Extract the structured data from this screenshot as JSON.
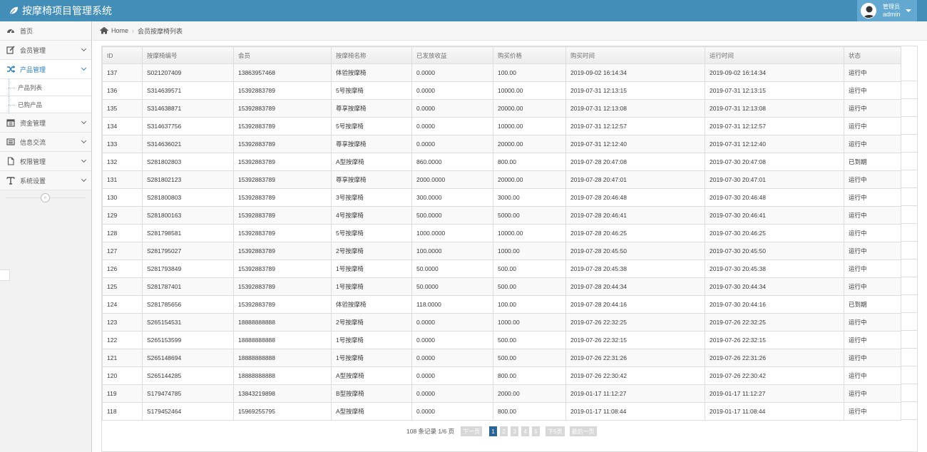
{
  "app": {
    "title": "按摩椅项目管理系统"
  },
  "user": {
    "role": "管理员",
    "name": "admin"
  },
  "sidebar": {
    "items": [
      {
        "label": "首页",
        "icon": "dashboard-icon",
        "expandable": false
      },
      {
        "label": "会员管理",
        "icon": "edit-icon",
        "expandable": true
      },
      {
        "label": "产品管理",
        "icon": "shuffle-icon",
        "expandable": true,
        "active": true
      }
    ],
    "subitems": [
      {
        "label": "产品列表"
      },
      {
        "label": "已购产品"
      }
    ],
    "items_after": [
      {
        "label": "资金管理",
        "icon": "calendar-icon",
        "expandable": true
      },
      {
        "label": "信息交流",
        "icon": "list-icon",
        "expandable": true
      },
      {
        "label": "权限管理",
        "icon": "file-icon",
        "expandable": true
      },
      {
        "label": "系统设置",
        "icon": "text-icon",
        "expandable": true
      }
    ],
    "collapse_glyph": "«"
  },
  "breadcrumb": {
    "home": "Home",
    "current": "会员按摩椅列表"
  },
  "table": {
    "columns": [
      "ID",
      "按摩椅编号",
      "会员",
      "按摩椅名称",
      "已发放收益",
      "购买价格",
      "购买时间",
      "运行时间",
      "状态"
    ],
    "rows": [
      [
        "137",
        "S021207409",
        "13863957468",
        "体验按摩椅",
        "0.0000",
        "100.00",
        "2019-09-02 16:14:34",
        "2019-09-02 16:14:34",
        "运行中"
      ],
      [
        "136",
        "S314639571",
        "15392883789",
        "5号按摩椅",
        "0.0000",
        "10000.00",
        "2019-07-31 12:13:15",
        "2019-07-31 12:13:15",
        "运行中"
      ],
      [
        "135",
        "S314638871",
        "15392883789",
        "尊享按摩椅",
        "0.0000",
        "20000.00",
        "2019-07-31 12:13:08",
        "2019-07-31 12:13:08",
        "运行中"
      ],
      [
        "134",
        "S314637756",
        "15392883789",
        "5号按摩椅",
        "0.0000",
        "10000.00",
        "2019-07-31 12:12:57",
        "2019-07-31 12:12:57",
        "运行中"
      ],
      [
        "133",
        "S314636021",
        "15392883789",
        "尊享按摩椅",
        "0.0000",
        "20000.00",
        "2019-07-31 12:12:40",
        "2019-07-31 12:12:40",
        "运行中"
      ],
      [
        "132",
        "S281802803",
        "15392883789",
        "A型按摩椅",
        "860.0000",
        "800.00",
        "2019-07-28 20:47:08",
        "2019-07-30 20:47:08",
        "已到期"
      ],
      [
        "131",
        "S281802123",
        "15392883789",
        "尊享按摩椅",
        "2000.0000",
        "20000.00",
        "2019-07-28 20:47:01",
        "2019-07-30 20:47:01",
        "运行中"
      ],
      [
        "130",
        "S281800803",
        "15392883789",
        "3号按摩椅",
        "300.0000",
        "3000.00",
        "2019-07-28 20:46:48",
        "2019-07-30 20:46:48",
        "运行中"
      ],
      [
        "129",
        "S281800163",
        "15392883789",
        "4号按摩椅",
        "500.0000",
        "5000.00",
        "2019-07-28 20:46:41",
        "2019-07-30 20:46:41",
        "运行中"
      ],
      [
        "128",
        "S281798581",
        "15392883789",
        "5号按摩椅",
        "1000.0000",
        "10000.00",
        "2019-07-28 20:46:25",
        "2019-07-30 20:46:25",
        "运行中"
      ],
      [
        "127",
        "S281795027",
        "15392883789",
        "2号按摩椅",
        "100.0000",
        "1000.00",
        "2019-07-28 20:45:50",
        "2019-07-30 20:45:50",
        "运行中"
      ],
      [
        "126",
        "S281793849",
        "15392883789",
        "1号按摩椅",
        "50.0000",
        "500.00",
        "2019-07-28 20:45:38",
        "2019-07-30 20:45:38",
        "运行中"
      ],
      [
        "125",
        "S281787401",
        "15392883789",
        "1号按摩椅",
        "50.0000",
        "500.00",
        "2019-07-28 20:44:34",
        "2019-07-30 20:44:34",
        "运行中"
      ],
      [
        "124",
        "S281785656",
        "15392883789",
        "体验按摩椅",
        "118.0000",
        "100.00",
        "2019-07-28 20:44:16",
        "2019-07-30 20:44:16",
        "已到期"
      ],
      [
        "123",
        "S265154531",
        "18888888888",
        "2号按摩椅",
        "0.0000",
        "1000.00",
        "2019-07-26 22:32:25",
        "2019-07-26 22:32:25",
        "运行中"
      ],
      [
        "122",
        "S265153599",
        "18888888888",
        "1号按摩椅",
        "0.0000",
        "500.00",
        "2019-07-26 22:32:15",
        "2019-07-26 22:32:15",
        "运行中"
      ],
      [
        "121",
        "S265148694",
        "18888888888",
        "1号按摩椅",
        "0.0000",
        "500.00",
        "2019-07-26 22:31:26",
        "2019-07-26 22:31:26",
        "运行中"
      ],
      [
        "120",
        "S265144285",
        "18888888888",
        "A型按摩椅",
        "0.0000",
        "800.00",
        "2019-07-26 22:30:42",
        "2019-07-26 22:30:42",
        "运行中"
      ],
      [
        "119",
        "S179474785",
        "13843219898",
        "B型按摩椅",
        "0.0000",
        "2000.00",
        "2019-01-17 11:12:27",
        "2019-01-17 11:12:27",
        "运行中"
      ],
      [
        "118",
        "S179452464",
        "15969255795",
        "A型按摩椅",
        "0.0000",
        "800.00",
        "2019-01-17 11:08:44",
        "2019-01-17 11:08:44",
        "运行中"
      ]
    ]
  },
  "pagination": {
    "info": "108 条记录 1/6 页",
    "prev_label": "下一页",
    "pages": [
      "1",
      "2",
      "3",
      "4",
      "5"
    ],
    "current_page": "1",
    "next5_label": "下5页",
    "last_label": "最后一页"
  }
}
